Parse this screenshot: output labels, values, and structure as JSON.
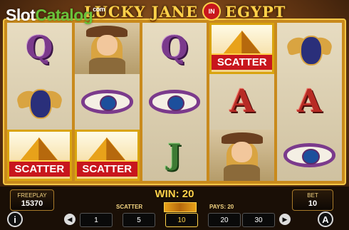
{
  "watermark": {
    "part1": "Slot",
    "part2": "Catalog",
    "part3": "com"
  },
  "title": {
    "left": "LUCKY JANE",
    "in": "IN",
    "right": "EGYPT"
  },
  "reels": [
    [
      "Q",
      "SCARAB",
      "SCATTER"
    ],
    [
      "WOMAN",
      "EYE",
      "SCATTER"
    ],
    [
      "Q",
      "EYE",
      "J"
    ],
    [
      "SCATTER",
      "A",
      "WOMAN"
    ],
    [
      "SCARAB",
      "A",
      "EYE"
    ]
  ],
  "scatter_label": "SCATTER",
  "freeplay": {
    "label": "FREEPLAY",
    "value": "15370"
  },
  "bet": {
    "label": "BET",
    "value": "10"
  },
  "win": "WIN: 20",
  "scatter_text": "SCATTER",
  "pays": "PAYS: 20",
  "stakes": [
    "1",
    "5",
    "10",
    "20",
    "30"
  ],
  "selected_stake": "10",
  "icons": {
    "info": "i",
    "prev": "◀",
    "next": "▶",
    "auto": "A"
  }
}
